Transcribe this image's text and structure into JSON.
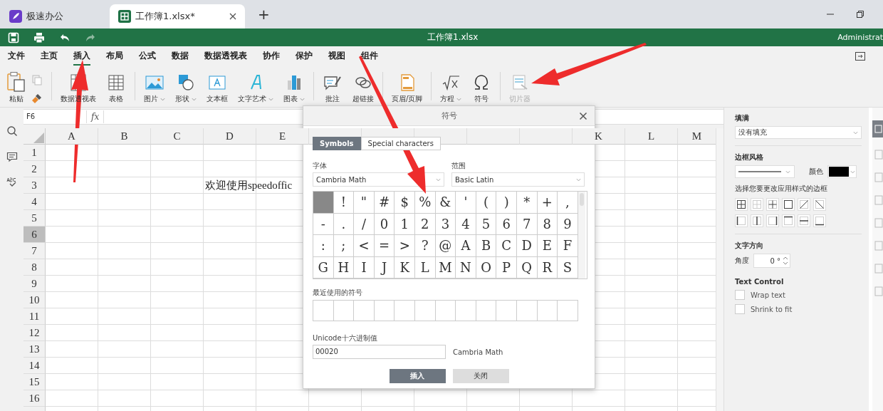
{
  "browser_tabs": [
    {
      "label": "极速办公",
      "selected": false
    },
    {
      "label": "工作簿1.xlsx*",
      "selected": true
    }
  ],
  "new_tab": "+",
  "title_bar": {
    "title": "工作簿1.xlsx",
    "user": "Administrat"
  },
  "menu": [
    {
      "label": "文件",
      "selected": false
    },
    {
      "label": "主页",
      "selected": false
    },
    {
      "label": "插入",
      "selected": true
    },
    {
      "label": "布局",
      "selected": false
    },
    {
      "label": "公式",
      "selected": false
    },
    {
      "label": "数据",
      "selected": false
    },
    {
      "label": "数据透视表",
      "selected": false
    },
    {
      "label": "协作",
      "selected": false
    },
    {
      "label": "保护",
      "selected": false
    },
    {
      "label": "视图",
      "selected": false
    },
    {
      "label": "组件",
      "selected": false
    }
  ],
  "ribbon": {
    "paste": "粘贴",
    "groups": [
      [
        {
          "label": "数据透视表",
          "dropdown": false,
          "disabled": false
        },
        {
          "label": "表格",
          "dropdown": false,
          "disabled": false
        }
      ],
      [
        {
          "label": "图片",
          "dropdown": true,
          "disabled": false
        },
        {
          "label": "形状",
          "dropdown": true,
          "disabled": false
        },
        {
          "label": "文本框",
          "dropdown": false,
          "disabled": false
        },
        {
          "label": "文字艺术",
          "dropdown": true,
          "disabled": false
        },
        {
          "label": "图表",
          "dropdown": true,
          "disabled": false
        }
      ],
      [
        {
          "label": "批注",
          "dropdown": false,
          "disabled": false
        },
        {
          "label": "超链接",
          "dropdown": false,
          "disabled": false
        }
      ],
      [
        {
          "label": "页眉/页脚",
          "dropdown": false,
          "disabled": false
        }
      ],
      [
        {
          "label": "方程",
          "dropdown": true,
          "disabled": false
        },
        {
          "label": "符号",
          "dropdown": false,
          "disabled": false
        }
      ],
      [
        {
          "label": "切片器",
          "dropdown": false,
          "disabled": true
        }
      ]
    ]
  },
  "formula_bar": {
    "name_box": "F6",
    "fx": "fx"
  },
  "sheet": {
    "columns_left": [
      "A",
      "B",
      "C",
      "D",
      "E"
    ],
    "columns_right": [
      "K",
      "L",
      "M"
    ],
    "rows": [
      {
        "label": "1",
        "selected": false
      },
      {
        "label": "2",
        "selected": false
      },
      {
        "label": "3",
        "selected": false
      },
      {
        "label": "4",
        "selected": false
      },
      {
        "label": "5",
        "selected": false
      },
      {
        "label": "6",
        "selected": true
      },
      {
        "label": "7",
        "selected": false
      },
      {
        "label": "8",
        "selected": false
      },
      {
        "label": "9",
        "selected": false
      },
      {
        "label": "10",
        "selected": false
      },
      {
        "label": "11",
        "selected": false
      },
      {
        "label": "12",
        "selected": false
      },
      {
        "label": "13",
        "selected": false
      },
      {
        "label": "14",
        "selected": false
      },
      {
        "label": "15",
        "selected": false
      },
      {
        "label": "16",
        "selected": false
      }
    ],
    "cell_text": "欢迎使用speedoffic"
  },
  "dialog": {
    "title": "符号",
    "tabs": [
      {
        "label": "Symbols",
        "selected": true
      },
      {
        "label": "Special characters",
        "selected": false
      }
    ],
    "font_label": "字体",
    "font": "Cambria Math",
    "range_label": "范围",
    "range": "Basic Latin",
    "symbols": [
      {
        "selected": true
      },
      {
        "char": "!",
        "selected": false
      },
      {
        "char": "\"",
        "selected": false
      },
      {
        "char": "#",
        "selected": false
      },
      {
        "char": "$",
        "selected": false
      },
      {
        "char": "%",
        "selected": false
      },
      {
        "char": "&",
        "selected": false
      },
      {
        "char": "'",
        "selected": false
      },
      {
        "char": "(",
        "selected": false
      },
      {
        "char": ")",
        "selected": false
      },
      {
        "char": "*",
        "selected": false
      },
      {
        "char": "+",
        "selected": false
      },
      {
        "char": ",",
        "selected": false
      },
      {
        "char": "-",
        "selected": false
      },
      {
        "char": ".",
        "selected": false
      },
      {
        "char": "/",
        "selected": false
      },
      {
        "char": "0",
        "selected": false
      },
      {
        "char": "1",
        "selected": false
      },
      {
        "char": "2",
        "selected": false
      },
      {
        "char": "3",
        "selected": false
      },
      {
        "char": "4",
        "selected": false
      },
      {
        "char": "5",
        "selected": false
      },
      {
        "char": "6",
        "selected": false
      },
      {
        "char": "7",
        "selected": false
      },
      {
        "char": "8",
        "selected": false
      },
      {
        "char": "9",
        "selected": false
      },
      {
        "char": ":",
        "selected": false
      },
      {
        "char": ";",
        "selected": false
      },
      {
        "char": "<",
        "selected": false
      },
      {
        "char": "=",
        "selected": false
      },
      {
        "char": ">",
        "selected": false
      },
      {
        "char": "?",
        "selected": false
      },
      {
        "char": "@",
        "selected": false
      },
      {
        "char": "A",
        "selected": false
      },
      {
        "char": "B",
        "selected": false
      },
      {
        "char": "C",
        "selected": false
      },
      {
        "char": "D",
        "selected": false
      },
      {
        "char": "E",
        "selected": false
      },
      {
        "char": "F",
        "selected": false
      },
      {
        "char": "G",
        "selected": false
      },
      {
        "char": "H",
        "selected": false
      },
      {
        "char": "I",
        "selected": false
      },
      {
        "char": "J",
        "selected": false
      },
      {
        "char": "K",
        "selected": false
      },
      {
        "char": "L",
        "selected": false
      },
      {
        "char": "M",
        "selected": false
      },
      {
        "char": "N",
        "selected": false
      },
      {
        "char": "O",
        "selected": false
      },
      {
        "char": "P",
        "selected": false
      },
      {
        "char": "Q",
        "selected": false
      },
      {
        "char": "R",
        "selected": false
      },
      {
        "char": "S",
        "selected": false
      }
    ],
    "recent_label": "最近使用的符号",
    "unicode_label": "Unicode十六进制值",
    "unicode": "00020",
    "font_name": "Cambria Math",
    "buttons": [
      {
        "label": "插入",
        "kind": "primary"
      },
      {
        "label": "关闭",
        "kind": "secondary"
      }
    ]
  },
  "panel": {
    "fill_label": "填满",
    "fill": "没有填充",
    "border_label": "边框风格",
    "color_label": "颜色",
    "border_hint": "选择您要更改应用样式的边框",
    "direction_label": "文字方向",
    "angle_label": "角度",
    "angle": "0 °",
    "text_control_label": "Text Control",
    "checks": [
      {
        "label": "Wrap text",
        "checked": false
      },
      {
        "label": "Shrink to fit",
        "checked": false
      }
    ]
  }
}
